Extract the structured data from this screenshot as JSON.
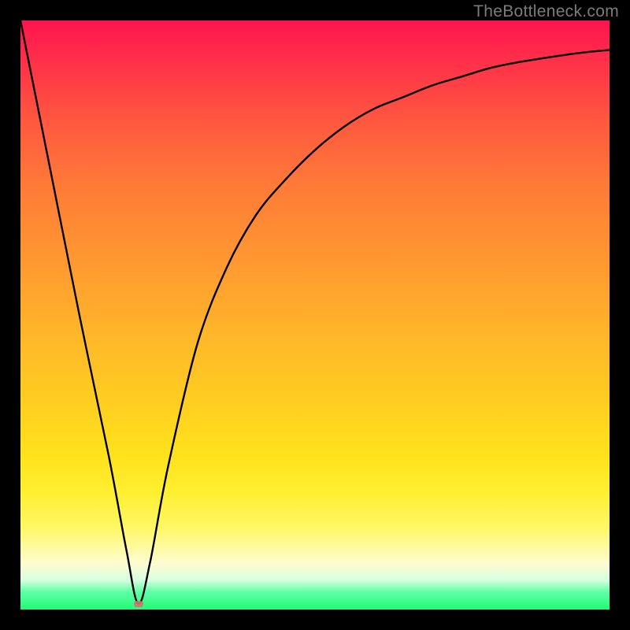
{
  "watermark": "TheBottleneck.com",
  "colors": {
    "frame": "#000000",
    "curve": "#000000",
    "marker": "#d3736e",
    "gradient_stops": [
      "#ff1450",
      "#ff3448",
      "#ff5b3f",
      "#ff7a38",
      "#ff9b30",
      "#ffba28",
      "#ffd020",
      "#ffe21c",
      "#ffef30",
      "#fff764",
      "#fffccf",
      "#d6ffe0",
      "#5fffa7",
      "#1ffc74"
    ]
  },
  "chart_data": {
    "type": "line",
    "title": "",
    "xlabel": "",
    "ylabel": "",
    "xlim": [
      0,
      100
    ],
    "ylim": [
      0,
      100
    ],
    "grid": false,
    "legend": false,
    "series": [
      {
        "name": "curve",
        "x": [
          0,
          5,
          10,
          15,
          18,
          20,
          22,
          25,
          30,
          35,
          40,
          45,
          50,
          55,
          60,
          65,
          70,
          75,
          80,
          85,
          90,
          95,
          100
        ],
        "y": [
          100,
          75,
          50,
          26,
          10,
          1,
          8,
          24,
          45,
          58,
          67,
          73,
          78,
          82,
          85,
          87,
          89,
          90.5,
          92,
          93,
          93.8,
          94.5,
          95
        ]
      }
    ],
    "annotations": [
      {
        "name": "minimum-marker",
        "x": 20,
        "y": 1
      }
    ]
  }
}
